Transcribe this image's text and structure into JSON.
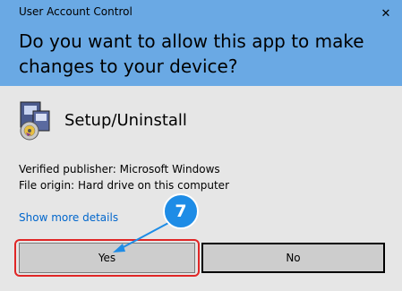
{
  "window": {
    "title": "User Account Control",
    "close_icon": "close-icon"
  },
  "header": {
    "question": "Do you want to allow this app to make changes to your device?"
  },
  "app": {
    "name": "Setup/Uninstall",
    "icon": "installer-icon"
  },
  "details": {
    "publisher_label": "Verified publisher:",
    "publisher_value": "Microsoft Windows",
    "origin_label": "File origin:",
    "origin_value": "Hard drive on this computer",
    "show_more_label": "Show more details"
  },
  "buttons": {
    "yes_label": "Yes",
    "no_label": "No"
  },
  "annotation": {
    "step_number": "7",
    "color": "#1e8ce6",
    "highlight_color": "#e02626"
  },
  "colors": {
    "header_bg": "#6aa9e4",
    "body_bg": "#e6e6e6",
    "link": "#0066cc",
    "button_bg": "#cdcdcd"
  }
}
